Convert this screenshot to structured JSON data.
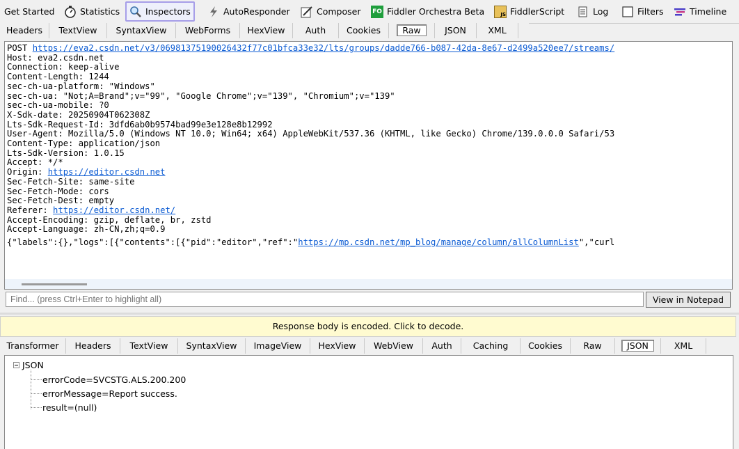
{
  "main_tabs": [
    {
      "label": "Get Started",
      "icon": "none"
    },
    {
      "label": "Statistics",
      "icon": "stopwatch-icon"
    },
    {
      "label": "Inspectors",
      "icon": "magnifier-icon"
    },
    {
      "label": "AutoResponder",
      "icon": "lightning-icon"
    },
    {
      "label": "Composer",
      "icon": "pencil-icon"
    },
    {
      "label": "Fiddler Orchestra Beta",
      "icon": "fo-badge-icon",
      "badge": "FO"
    },
    {
      "label": "FiddlerScript",
      "icon": "script-icon",
      "badge": "JS"
    },
    {
      "label": "Log",
      "icon": "log-icon"
    },
    {
      "label": "Filters",
      "icon": "checkbox-icon"
    },
    {
      "label": "Timeline",
      "icon": "timeline-icon"
    }
  ],
  "request_tabs": [
    "Headers",
    "TextView",
    "SyntaxView",
    "WebForms",
    "HexView",
    "Auth",
    "Cookies",
    "Raw",
    "JSON",
    "XML"
  ],
  "raw": {
    "request_line_method": "POST ",
    "request_url": "https://eva2.csdn.net/v3/06981375190026432f77c01bfca33e32/lts/groups/dadde766-b087-42da-8e67-d2499a520ee7/streams/",
    "l_host": "Host: eva2.csdn.net",
    "l_connection": "Connection: keep-alive",
    "l_content_length": "Content-Length: 1244",
    "l_platform": "sec-ch-ua-platform: \"Windows\"",
    "l_ua": "sec-ch-ua: \"Not;A=Brand\";v=\"99\", \"Google Chrome\";v=\"139\", \"Chromium\";v=\"139\"",
    "l_mobile": "sec-ch-ua-mobile: ?0",
    "l_sdk_date": "X-Sdk-date: 20250904T062308Z",
    "l_request_id": "Lts-Sdk-Request-Id: 3dfd6ab0b9574bad99e3e128e8b12992",
    "l_user_agent": "User-Agent: Mozilla/5.0 (Windows NT 10.0; Win64; x64) AppleWebKit/537.36 (KHTML, like Gecko) Chrome/139.0.0.0 Safari/53",
    "l_content_type": "Content-Type: application/json",
    "l_sdk_version": "Lts-Sdk-Version: 1.0.15",
    "l_accept": "Accept: */*",
    "origin_label": "Origin: ",
    "origin_url": "https://editor.csdn.net",
    "l_fetch_site": "Sec-Fetch-Site: same-site",
    "l_fetch_mode": "Sec-Fetch-Mode: cors",
    "l_fetch_dest": "Sec-Fetch-Dest: empty",
    "referer_label": "Referer: ",
    "referer_url": "https://editor.csdn.net/",
    "l_accept_encoding": "Accept-Encoding: gzip, deflate, br, zstd",
    "l_accept_language": "Accept-Language: zh-CN,zh;q=0.9",
    "body_prefix": "{\"labels\":{},\"logs\":[{\"contents\":[{\"pid\":\"editor\",\"ref\":\"",
    "body_url": "https://mp.csdn.net/mp_blog/manage/column/allColumnList",
    "body_suffix": "\",\"curl"
  },
  "find": {
    "placeholder": "Find... (press Ctrl+Enter to highlight all)",
    "notepad_button": "View in Notepad"
  },
  "response_banner": "Response body is encoded. Click to decode.",
  "response_tabs": [
    "Transformer",
    "Headers",
    "TextView",
    "SyntaxView",
    "ImageView",
    "HexView",
    "WebView",
    "Auth",
    "Caching",
    "Cookies",
    "Raw",
    "JSON",
    "XML"
  ],
  "json_tree": {
    "root": "JSON",
    "items": [
      "errorCode=SVCSTG.ALS.200.200",
      "errorMessage=Report success.",
      "result=(null)"
    ]
  },
  "colors": {
    "active_tab_border": "#a69ee8",
    "link": "#0b5bd3",
    "banner_bg": "#fffbd0",
    "fo_green": "#1f9e3c"
  }
}
